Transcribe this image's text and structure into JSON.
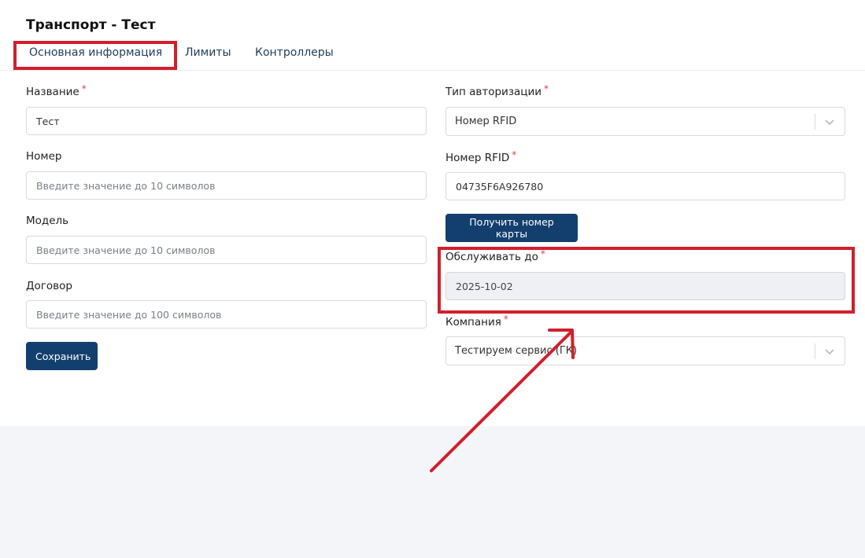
{
  "page": {
    "title": "Транспорт - Тест"
  },
  "tabs": [
    {
      "label": "Основная информация"
    },
    {
      "label": "Лимиты"
    },
    {
      "label": "Контроллеры"
    }
  ],
  "form_left": {
    "name": {
      "label": "Название",
      "required_mark": "*",
      "value": "Тест"
    },
    "number": {
      "label": "Номер",
      "placeholder": "Введите значение до 10 символов"
    },
    "model": {
      "label": "Модель",
      "placeholder": "Введите значение до 10 символов"
    },
    "contract": {
      "label": "Договор",
      "placeholder": "Введите значение до 100 символов"
    },
    "save_label": "Сохранить"
  },
  "form_right": {
    "auth_type": {
      "label": "Тип авторизации",
      "required_mark": "*",
      "value": "Номер RFID"
    },
    "rfid": {
      "label": "Номер RFID",
      "required_mark": "*",
      "value": "04735F6A926780"
    },
    "get_card_label": "Получить номер карты",
    "serve_until": {
      "label": "Обслуживать до",
      "required_mark": "*",
      "value": "2025-10-02"
    },
    "company": {
      "label": "Компания",
      "required_mark": "*",
      "value": "Тестируем сервис (ГК)"
    }
  },
  "colors": {
    "accent": "#133f6e",
    "annotation": "#d21f2c",
    "required": "#e0433a",
    "background": "#f4f5f9"
  }
}
